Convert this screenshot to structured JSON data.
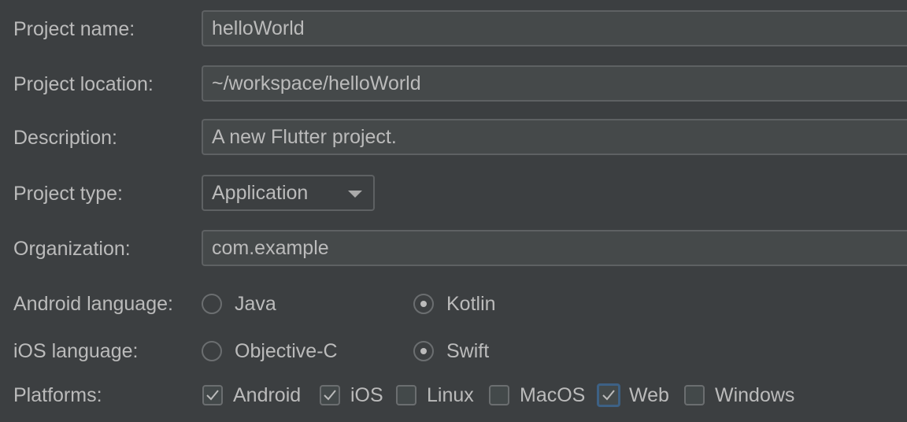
{
  "form": {
    "project_name": {
      "label": "Project name:",
      "value": "helloWorld"
    },
    "project_location": {
      "label": "Project location:",
      "value": "~/workspace/helloWorld"
    },
    "description": {
      "label": "Description:",
      "value": "A new Flutter project."
    },
    "project_type": {
      "label": "Project type:",
      "selected": "Application"
    },
    "organization": {
      "label": "Organization:",
      "value": "com.example"
    },
    "android_language": {
      "label": "Android language:",
      "options": [
        {
          "label": "Java",
          "checked": false
        },
        {
          "label": "Kotlin",
          "checked": true
        }
      ]
    },
    "ios_language": {
      "label": "iOS language:",
      "options": [
        {
          "label": "Objective-C",
          "checked": false
        },
        {
          "label": "Swift",
          "checked": true
        }
      ]
    },
    "platforms": {
      "label": "Platforms:",
      "options": [
        {
          "label": "Android",
          "checked": true
        },
        {
          "label": "iOS",
          "checked": true
        },
        {
          "label": "Linux",
          "checked": false
        },
        {
          "label": "MacOS",
          "checked": false
        },
        {
          "label": "Web",
          "checked": true,
          "focused": true
        },
        {
          "label": "Windows",
          "checked": false
        }
      ]
    }
  },
  "colors": {
    "background": "#3c3f41",
    "field_background": "#45494a",
    "field_border": "#5e6163",
    "text": "#bbbbbb",
    "focus_ring": "#3d6185"
  },
  "icons": {
    "dropdown": "chevron-down-icon",
    "checkmark": "checkmark-icon"
  }
}
